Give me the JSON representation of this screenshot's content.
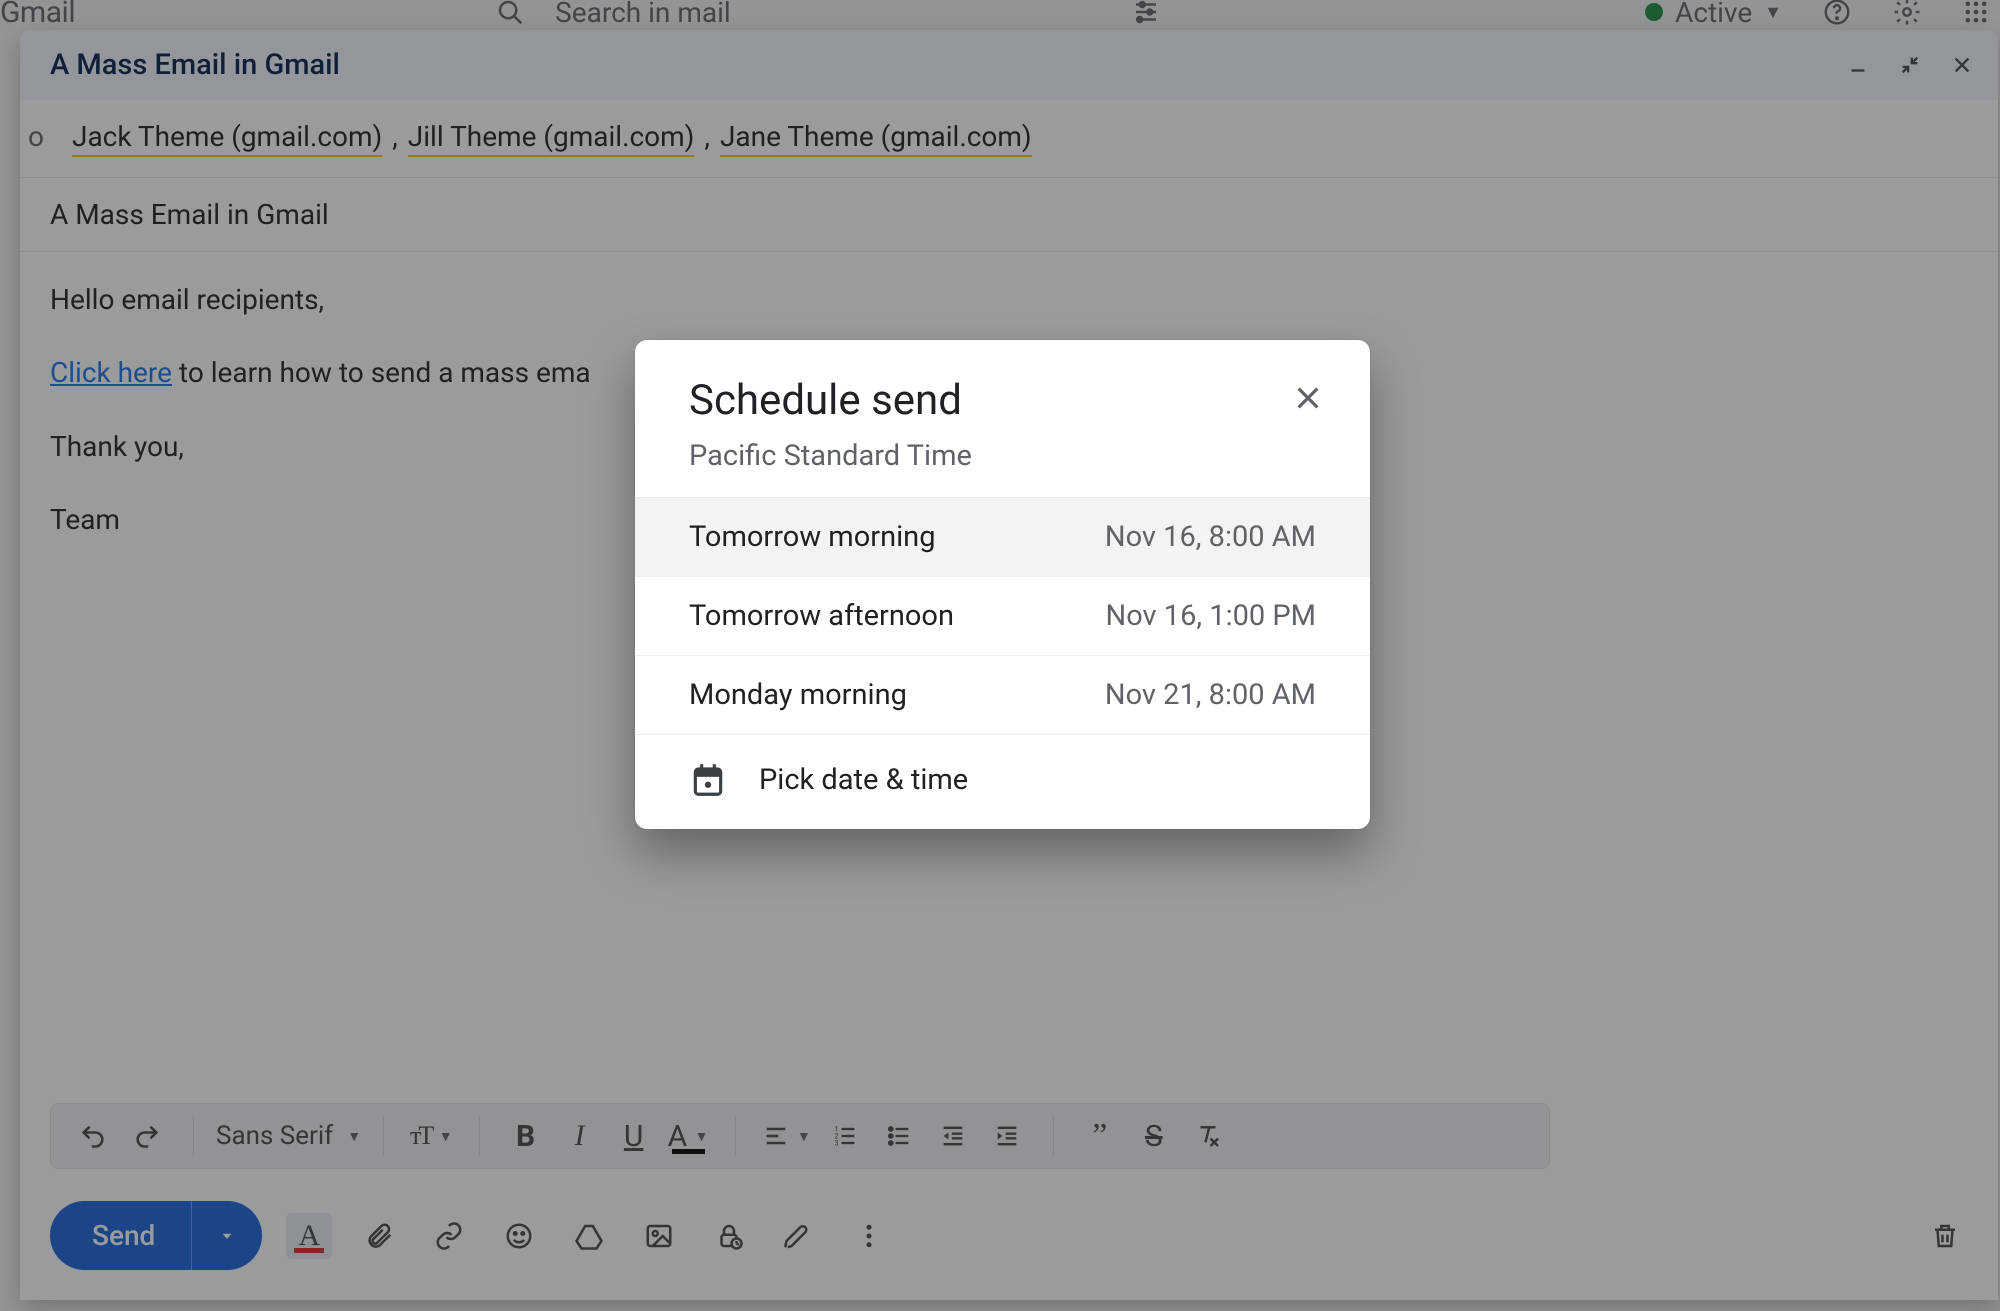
{
  "app": {
    "brand": "Gmail",
    "search_placeholder": "Search in mail",
    "status_label": "Active"
  },
  "compose": {
    "title": "A Mass Email in Gmail",
    "to_label": "o",
    "recipients": [
      "Jack Theme (gmail.com)",
      "Jill Theme (gmail.com)",
      "Jane Theme (gmail.com)"
    ],
    "subject": "A Mass Email in Gmail",
    "body": {
      "greeting": "Hello email recipients,",
      "link_text": "Click here",
      "line2_rest": " to learn how to send a mass ema",
      "thanks": "Thank you,",
      "signature": "Team"
    }
  },
  "fmt": {
    "font_name": "Sans Serif"
  },
  "actions": {
    "send_label": "Send"
  },
  "dialog": {
    "title": "Schedule send",
    "subtitle": "Pacific Standard Time",
    "options": [
      {
        "label": "Tomorrow morning",
        "datetime": "Nov 16, 8:00 AM"
      },
      {
        "label": "Tomorrow afternoon",
        "datetime": "Nov 16, 1:00 PM"
      },
      {
        "label": "Monday morning",
        "datetime": "Nov 21, 8:00 AM"
      }
    ],
    "pick_label": "Pick date & time"
  }
}
